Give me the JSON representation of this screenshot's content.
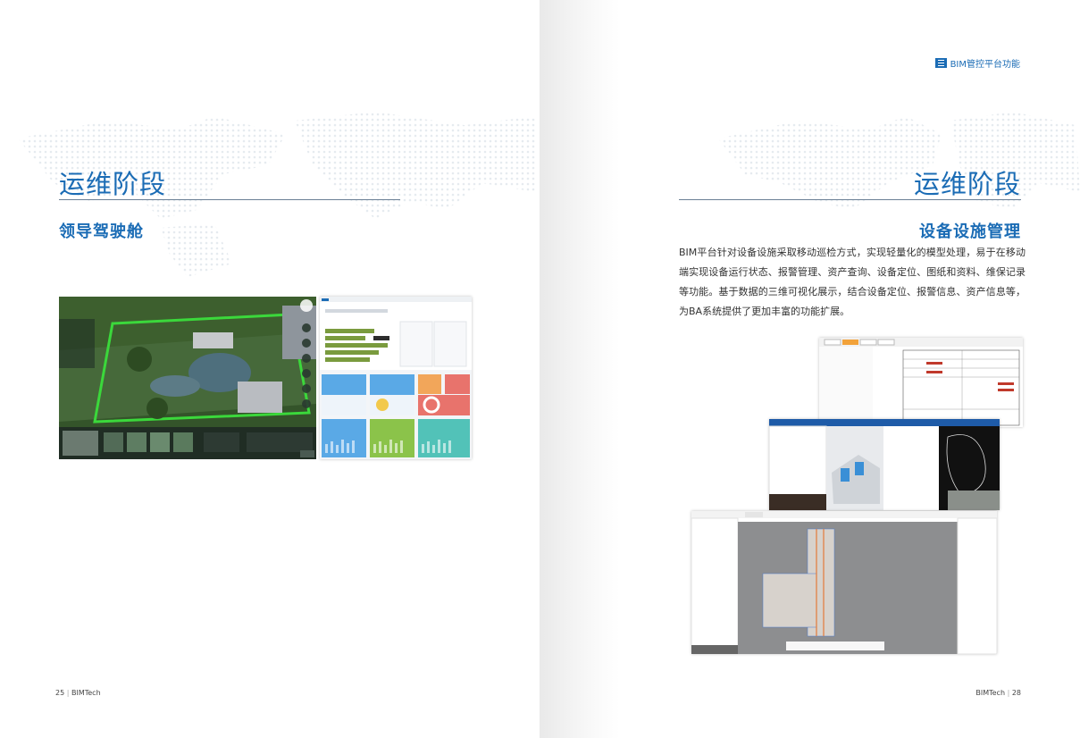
{
  "left": {
    "section_title": "运维阶段",
    "sub_title": "领导驾驶舱",
    "page_number": "25",
    "footer_brand": "BIMTech"
  },
  "right": {
    "header_tag": "BIM管控平台功能",
    "section_title": "运维阶段",
    "sub_title": "设备设施管理",
    "paragraph": "BIM平台针对设备设施采取移动巡检方式，实现轻量化的模型处理，易于在移动端实现设备运行状态、报警管理、资产查询、设备定位、图纸和资料、维保记录等功能。基于数据的三维可视化展示，结合设备定位、报警信息、资产信息等，为BA系统提供了更加丰富的功能扩展。",
    "page_number": "28",
    "footer_brand": "BIMTech"
  },
  "colors": {
    "accent": "#1b6cb5",
    "rule": "#6a7f95",
    "dashboard_green": "#8bc34a",
    "dashboard_blue": "#5aa9e6",
    "dashboard_orange": "#f2a65a",
    "dashboard_red": "#e8736c"
  },
  "icons": [
    "menu-lines-icon"
  ]
}
